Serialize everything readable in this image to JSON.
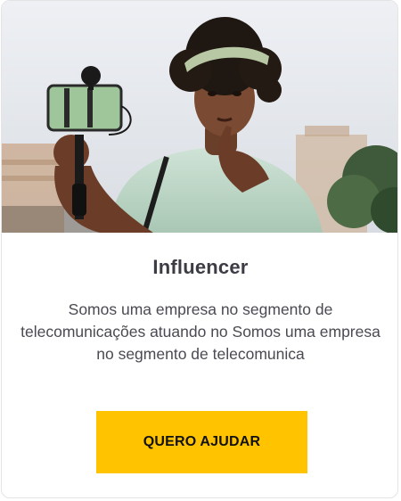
{
  "card": {
    "title": "Influencer",
    "description": "Somos uma empresa no segmento de telecomunicações atuando no Somos uma empresa no segmento de telecomunica",
    "cta_label": "QUERO AJUDAR"
  },
  "colors": {
    "accent": "#ffc300",
    "title": "#3c3c44",
    "text": "#4a4a52"
  }
}
